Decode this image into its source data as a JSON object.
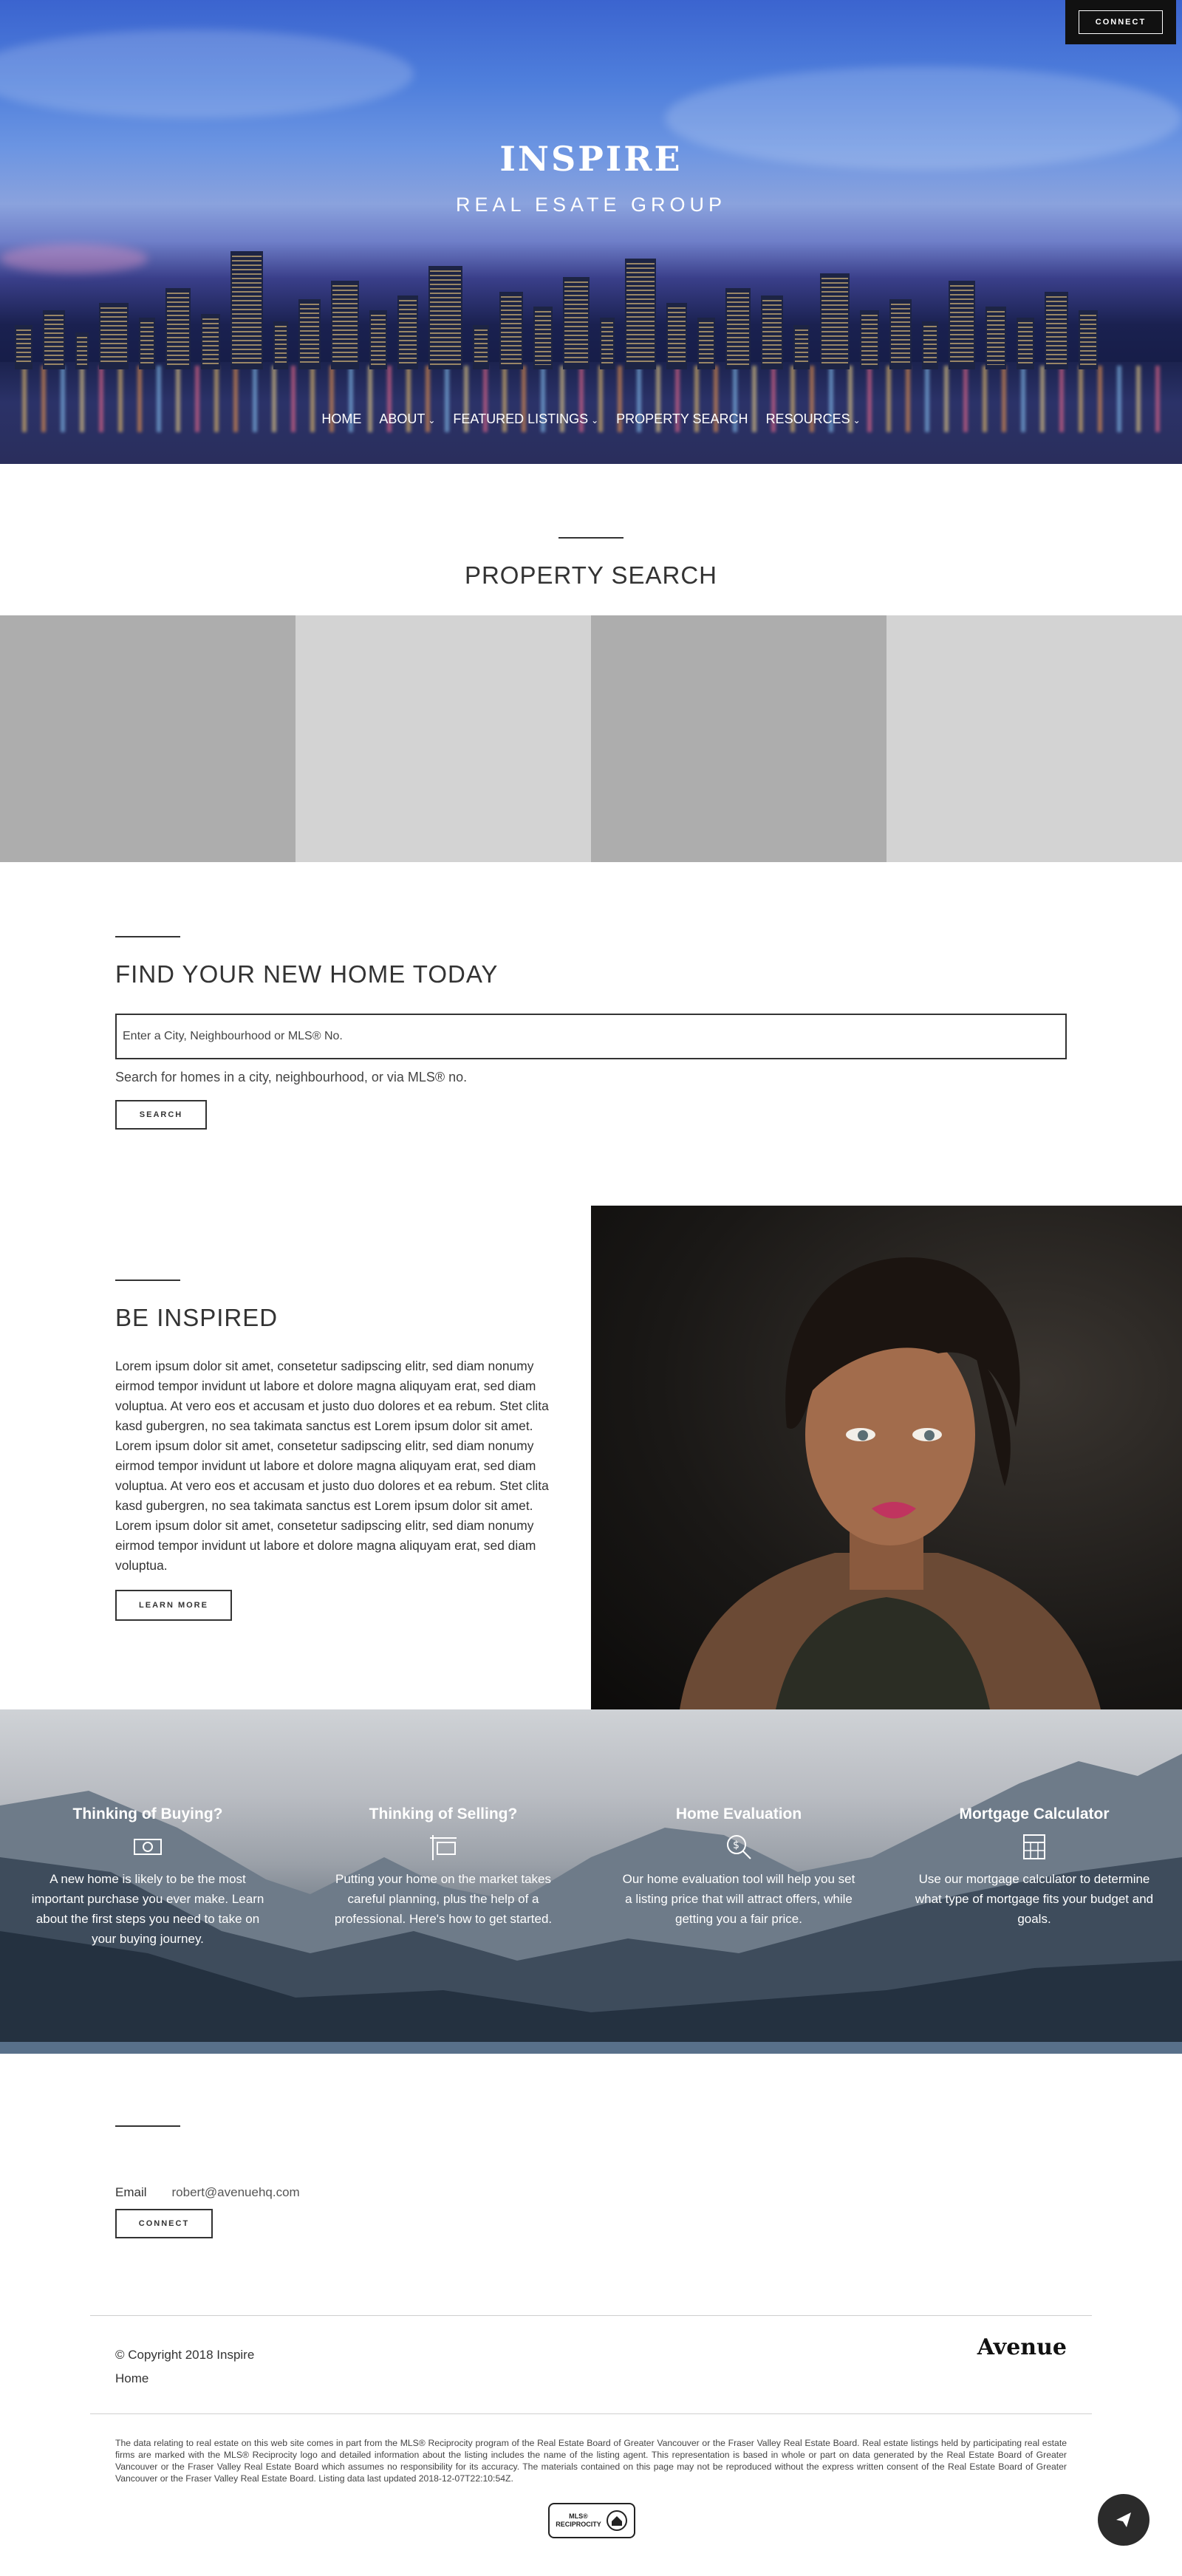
{
  "header": {
    "connect_label": "CONNECT",
    "title": "INSPIRE",
    "subtitle": "REAL ESATE GROUP"
  },
  "nav": {
    "items": [
      {
        "label": "HOME",
        "dropdown": false
      },
      {
        "label": "ABOUT",
        "dropdown": true
      },
      {
        "label": "FEATURED LISTINGS",
        "dropdown": true
      },
      {
        "label": "PROPERTY SEARCH",
        "dropdown": false
      },
      {
        "label": "RESOURCES",
        "dropdown": true
      }
    ]
  },
  "property_search": {
    "heading": "PROPERTY SEARCH",
    "tile_colors": [
      "#adadad",
      "#d3d3d3",
      "#adadad",
      "#d3d3d3"
    ]
  },
  "find_home": {
    "heading": "FIND YOUR NEW HOME TODAY",
    "input_placeholder": "Enter a City, Neighbourhood or MLS® No.",
    "hint": "Search for homes in a city, neighbourhood, or via MLS® no.",
    "search_label": "SEARCH"
  },
  "inspired": {
    "heading": "BE INSPIRED",
    "body": "Lorem ipsum dolor sit amet, consetetur sadipscing elitr, sed diam nonumy eirmod tempor invidunt ut labore et dolore magna aliquyam erat, sed diam voluptua. At vero eos et accusam et justo duo dolores et ea rebum. Stet clita kasd gubergren, no sea takimata sanctus est Lorem ipsum dolor sit amet. Lorem ipsum dolor sit amet, consetetur sadipscing elitr, sed diam nonumy eirmod tempor invidunt ut labore et dolore magna aliquyam erat, sed diam voluptua. At vero eos et accusam et justo duo dolores et ea rebum. Stet clita kasd gubergren, no sea takimata sanctus est Lorem ipsum dolor sit amet. Lorem ipsum dolor sit amet, consetetur sadipscing elitr, sed diam nonumy eirmod tempor invidunt ut labore et dolore magna aliquyam erat, sed diam voluptua.",
    "learn_more_label": "LEARN MORE"
  },
  "services": [
    {
      "title": "Thinking of Buying?",
      "icon": "money-icon",
      "text": "A new home is likely to be the most important purchase you ever make. Learn about the first steps you need to take on your buying journey."
    },
    {
      "title": "Thinking of Selling?",
      "icon": "sign-icon",
      "text": "Putting your home on the market takes careful planning, plus the help of a professional. Here's how to get started."
    },
    {
      "title": "Home Evaluation",
      "icon": "search-dollar-icon",
      "text": "Our home evaluation tool will help you set a listing price that will attract offers, while getting you a fair price."
    },
    {
      "title": "Mortgage Calculator",
      "icon": "calculator-icon",
      "text": "Use our mortgage calculator to determine what type of mortgage fits your budget and goals."
    }
  ],
  "contact": {
    "email_label": "Email",
    "email_value": "robert@avenuehq.com",
    "connect_label": "CONNECT"
  },
  "footer": {
    "copyright": "© Copyright 2018 Inspire",
    "home_link": "Home",
    "brand": "Avenue",
    "disclaimer": "The data relating to real estate on this web site comes in part from the MLS® Reciprocity program of the Real Estate Board of Greater Vancouver or the Fraser Valley Real Estate Board. Real estate listings held by participating real estate firms are marked with the MLS® Reciprocity logo and detailed information about the listing includes the name of the listing agent. This representation is based in whole or part on data generated by the Real Estate Board of Greater Vancouver or the Fraser Valley Real Estate Board which assumes no responsibility for its accuracy. The materials contained on this page may not be reproduced without the express written consent of the Real Estate Board of Greater Vancouver or the Fraser Valley Real Estate Board. Listing data last updated 2018-12-07T22:10:54Z.",
    "mls_line1": "MLS®",
    "mls_line2": "RECIPROCITY"
  }
}
